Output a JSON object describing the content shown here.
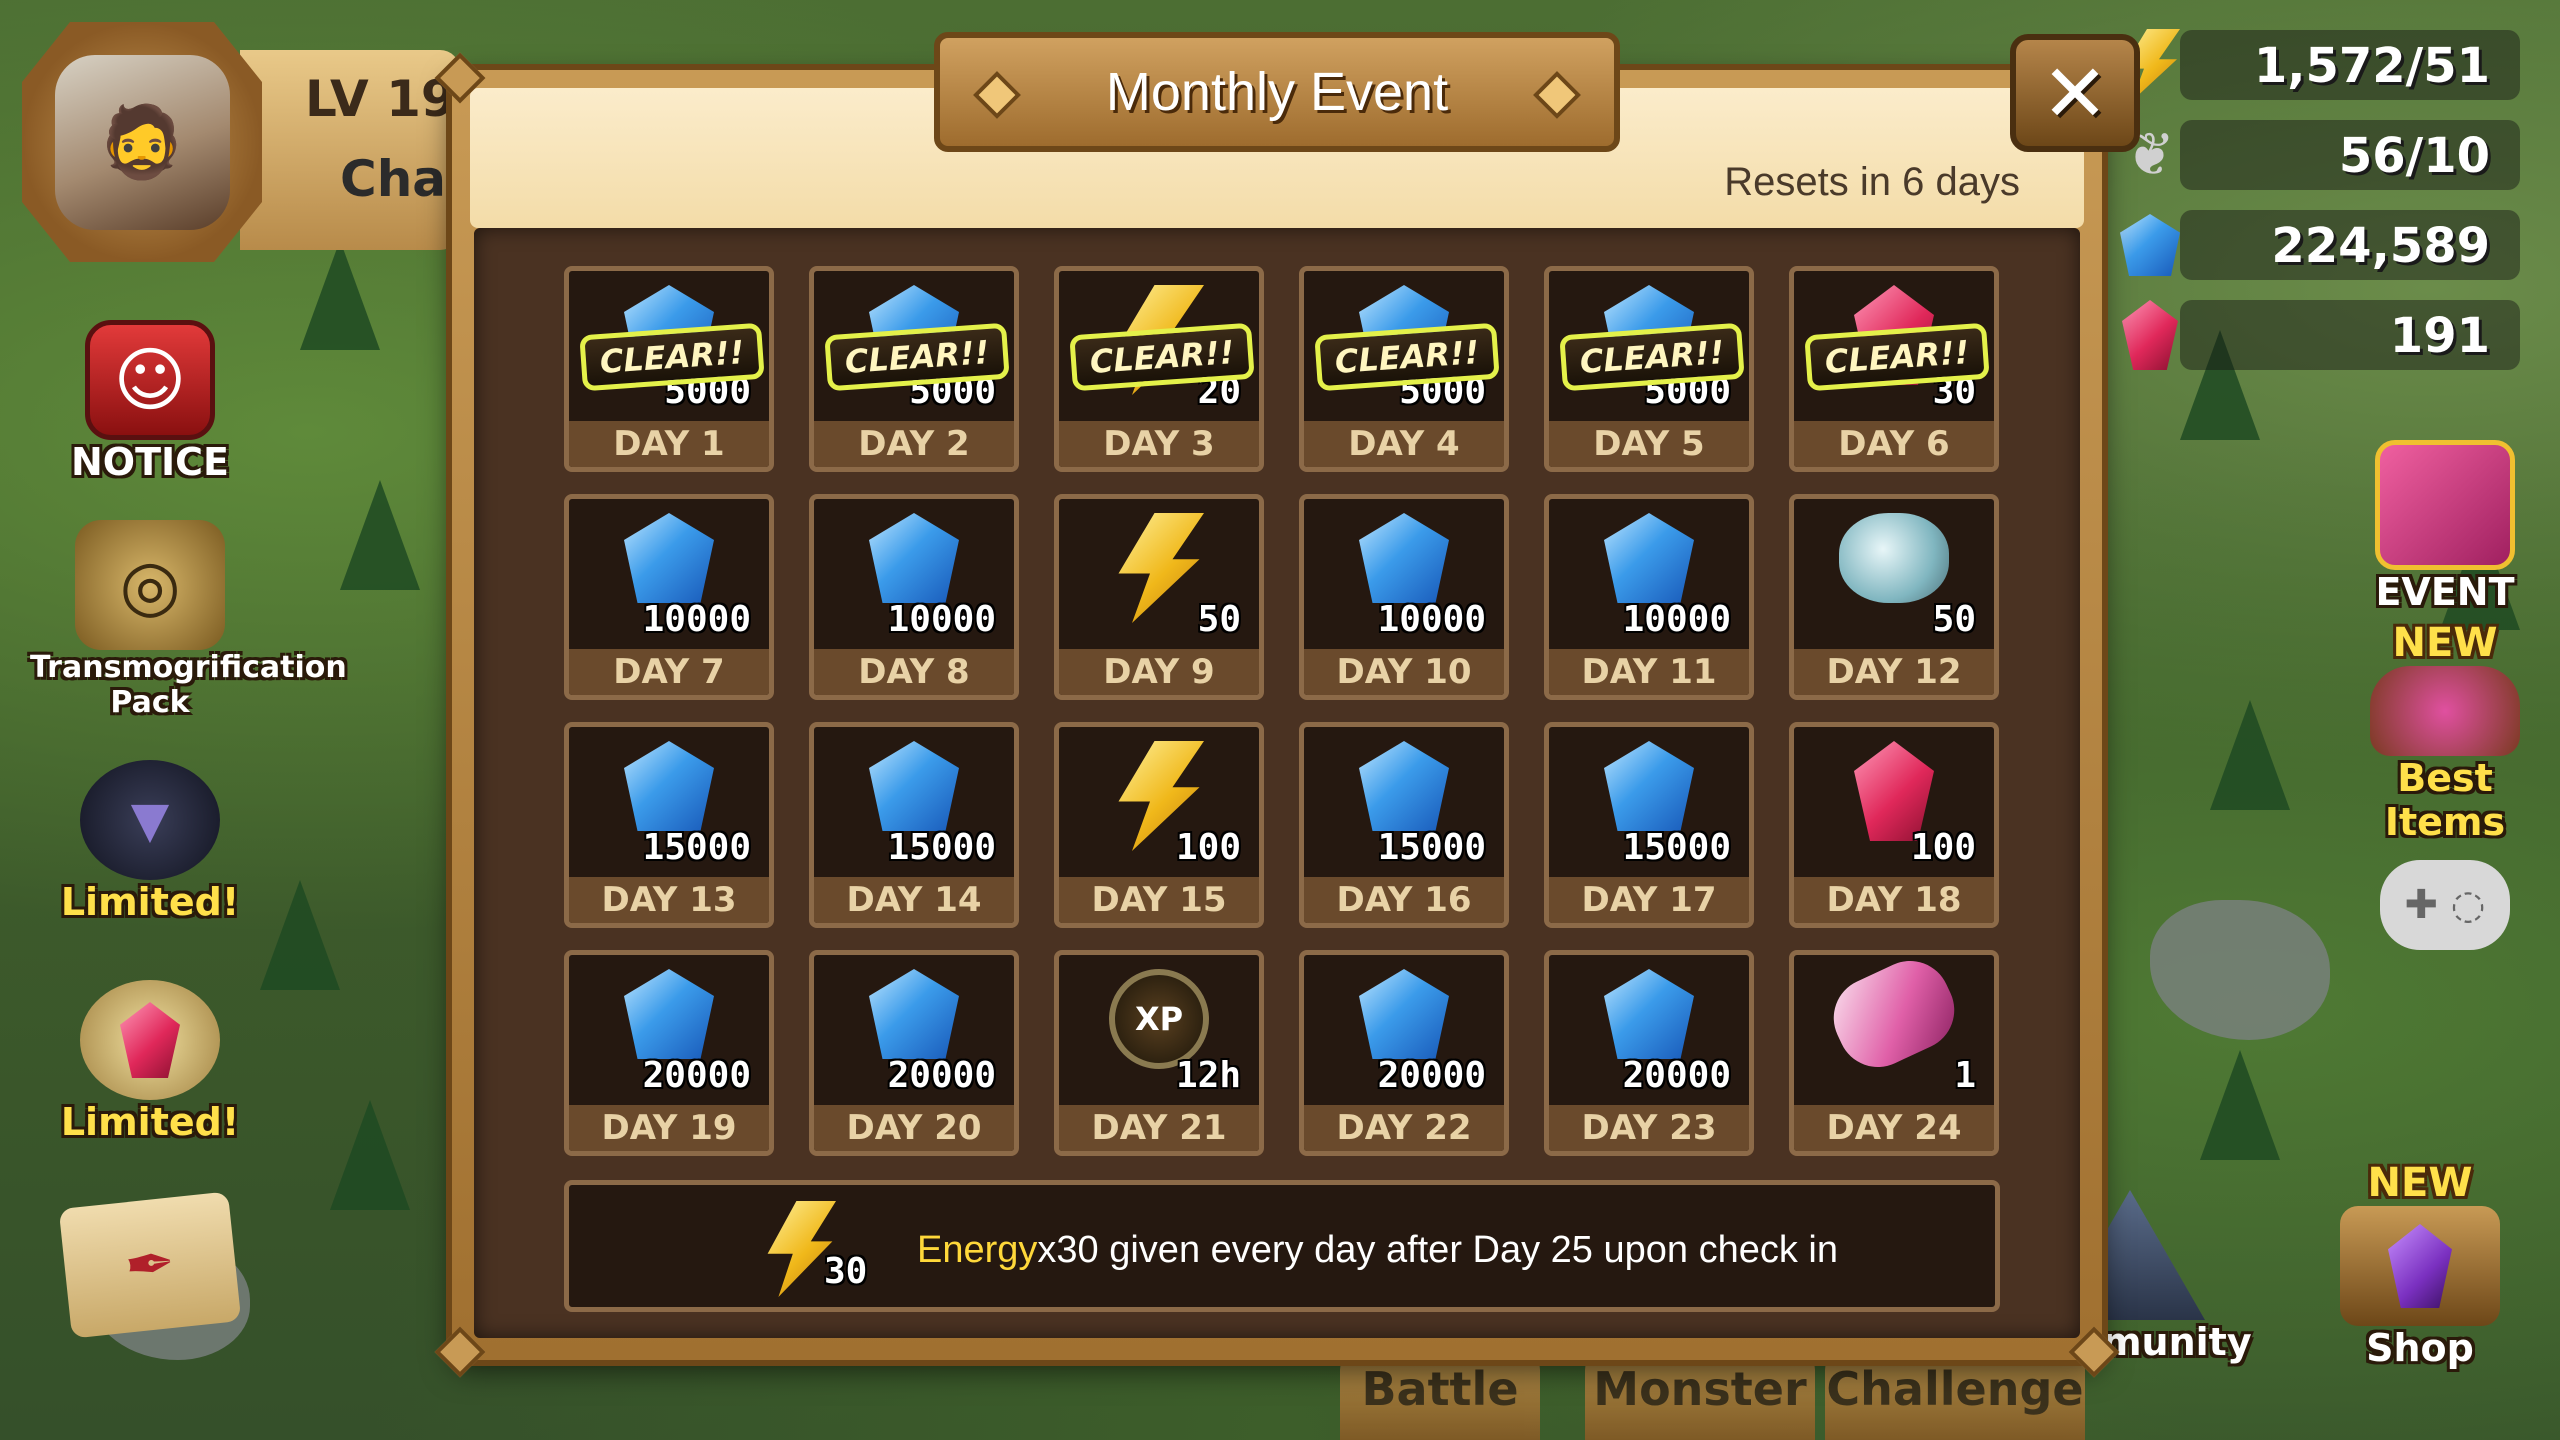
{
  "player": {
    "level_label": "LV 19",
    "name": "Chad"
  },
  "left_menu": [
    {
      "label": "NOTICE",
      "icon": "notice-icon"
    },
    {
      "label": "Transmogrification Pack",
      "icon": "transmog-icon"
    },
    {
      "label": "Limited!",
      "icon": "bat-monster-icon"
    },
    {
      "label": "Limited!",
      "icon": "crystal-pile-icon"
    },
    {
      "label": "",
      "icon": "quest-scroll-icon"
    }
  ],
  "resources": [
    {
      "name": "energy",
      "value": "1,572/51",
      "icon": "energy-icon",
      "color": "#f0b81a"
    },
    {
      "name": "arena-wings",
      "value": "56/10",
      "icon": "wings-icon",
      "color": "#c8c8c8"
    },
    {
      "name": "mana",
      "value": "224,589",
      "icon": "mana-crystal-icon",
      "color": "#3b9bea"
    },
    {
      "name": "crystal",
      "value": "191",
      "icon": "red-crystal-icon",
      "color": "#e0285a"
    }
  ],
  "right_menu": {
    "event_label": "EVENT",
    "best_items_new": "NEW",
    "best_items_label": "Best Items",
    "gamepad_icon": "gamepad-icon"
  },
  "bottom_nav": {
    "battle": "Battle",
    "monster": "Monster",
    "challenge": "Challenge",
    "community": "Community",
    "shop_new": "NEW",
    "shop": "Shop"
  },
  "modal": {
    "title": "Monthly Event",
    "reset_text": "Resets in 6 days",
    "close_label": "✕",
    "clear_label": "CLEAR!!",
    "days": [
      {
        "day": "DAY 1",
        "amount": "5000",
        "reward": "mana",
        "cleared": true
      },
      {
        "day": "DAY 2",
        "amount": "5000",
        "reward": "mana",
        "cleared": true
      },
      {
        "day": "DAY 3",
        "amount": "20",
        "reward": "energy",
        "cleared": true
      },
      {
        "day": "DAY 4",
        "amount": "5000",
        "reward": "mana",
        "cleared": true
      },
      {
        "day": "DAY 5",
        "amount": "5000",
        "reward": "mana",
        "cleared": true
      },
      {
        "day": "DAY 6",
        "amount": "30",
        "reward": "crystal",
        "cleared": true
      },
      {
        "day": "DAY 7",
        "amount": "10000",
        "reward": "mana",
        "cleared": false
      },
      {
        "day": "DAY 8",
        "amount": "10000",
        "reward": "mana",
        "cleared": false
      },
      {
        "day": "DAY 9",
        "amount": "50",
        "reward": "energy",
        "cleared": false
      },
      {
        "day": "DAY 10",
        "amount": "10000",
        "reward": "mana",
        "cleared": false
      },
      {
        "day": "DAY 11",
        "amount": "10000",
        "reward": "mana",
        "cleared": false
      },
      {
        "day": "DAY 12",
        "amount": "50",
        "reward": "rune",
        "cleared": false
      },
      {
        "day": "DAY 13",
        "amount": "15000",
        "reward": "mana",
        "cleared": false
      },
      {
        "day": "DAY 14",
        "amount": "15000",
        "reward": "mana",
        "cleared": false
      },
      {
        "day": "DAY 15",
        "amount": "100",
        "reward": "energy",
        "cleared": false
      },
      {
        "day": "DAY 16",
        "amount": "15000",
        "reward": "mana",
        "cleared": false
      },
      {
        "day": "DAY 17",
        "amount": "15000",
        "reward": "mana",
        "cleared": false
      },
      {
        "day": "DAY 18",
        "amount": "100",
        "reward": "crystal",
        "cleared": false
      },
      {
        "day": "DAY 19",
        "amount": "20000",
        "reward": "mana",
        "cleared": false
      },
      {
        "day": "DAY 20",
        "amount": "20000",
        "reward": "mana",
        "cleared": false
      },
      {
        "day": "DAY 21",
        "amount": "12h",
        "reward": "xp",
        "cleared": false
      },
      {
        "day": "DAY 22",
        "amount": "20000",
        "reward": "mana",
        "cleared": false
      },
      {
        "day": "DAY 23",
        "amount": "20000",
        "reward": "mana",
        "cleared": false
      },
      {
        "day": "DAY 24",
        "amount": "1",
        "reward": "scroll",
        "cleared": false
      }
    ],
    "info_bar": {
      "amount": "30",
      "highlight": "Energy",
      "text": "x30 given every day after Day 25 upon check in"
    }
  }
}
